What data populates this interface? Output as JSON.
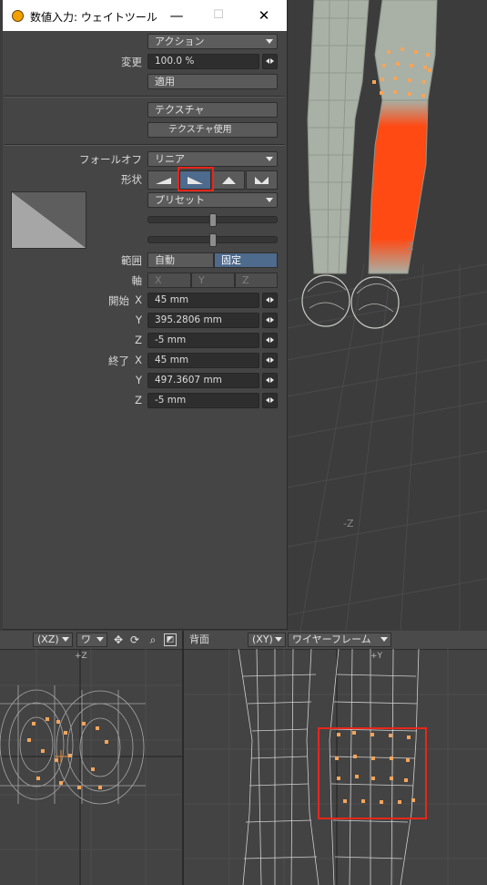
{
  "window": {
    "title": "数値入力: ウェイトツール"
  },
  "panel": {
    "action_label": "アクション",
    "change_label": "変更",
    "change_value": "100.0 %",
    "apply_label": "適用",
    "texture_label": "テクスチャ",
    "use_texture_label": "テクスチャ使用",
    "falloff_label": "フォールオフ",
    "falloff_value": "リニア",
    "shape_label": "形状",
    "preset_label": "プリセット",
    "range_label": "範囲",
    "range_auto": "自動",
    "range_fixed": "固定",
    "axis_label": "軸",
    "axis_x": "X",
    "axis_y": "Y",
    "axis_z": "Z",
    "start_label": "開始",
    "end_label": "終了",
    "x_label": "X",
    "y_label": "Y",
    "z_label": "Z",
    "start_x": "45 mm",
    "start_y": "395.2806 mm",
    "start_z": "-5 mm",
    "end_x": "45 mm",
    "end_y": "497.3607 mm",
    "end_z": "-5 mm",
    "shape_selected_index": 1
  },
  "viewport3d": {
    "axis_label_minus_z": "-Z",
    "axis_label_z": "Z"
  },
  "viewport_left": {
    "view_label": "(XZ)",
    "mode_label": "ワ",
    "axis_label": "+Z"
  },
  "viewport_right": {
    "view_name": "背面",
    "view_label": "(XY)",
    "mode_label": "ワイヤーフレーム",
    "axis_label": "+Y"
  },
  "colors": {
    "highlight_red": "#e8261a",
    "selection_orange": "#f5a55a",
    "weight_red": "#ff4a14",
    "selected_button": "#4e6a8c"
  }
}
